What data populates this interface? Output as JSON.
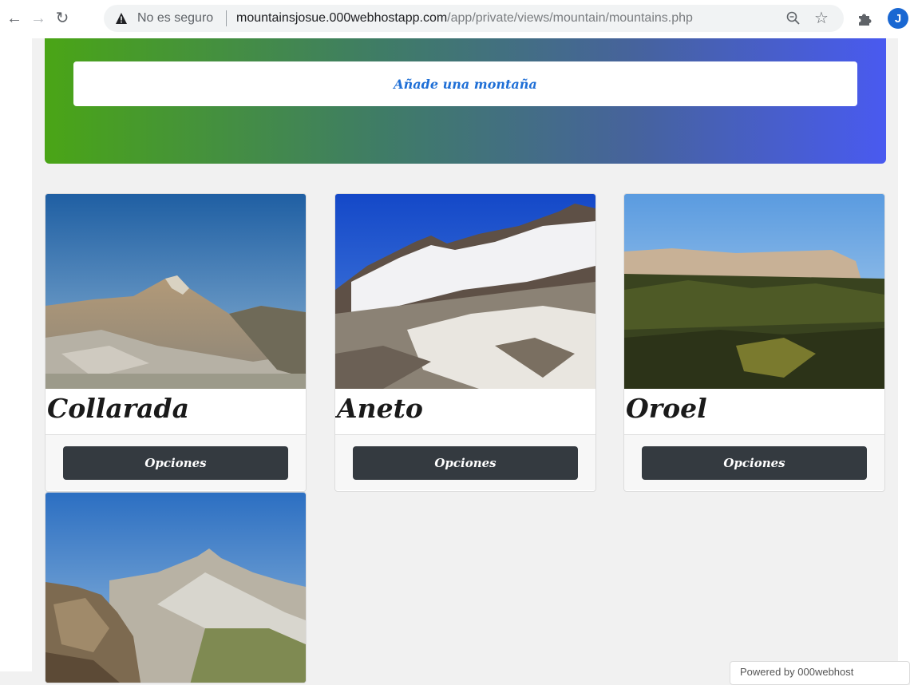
{
  "browser": {
    "security_label": "No es seguro",
    "url_host": "mountainsjosue.000webhostapp.com",
    "url_path": "/app/private/views/mountain/mountains.php",
    "avatar_letter": "J"
  },
  "hero": {
    "add_button_label": "Añade una montaña",
    "gradient_start": "#4aa516",
    "gradient_end": "#495af0"
  },
  "mountains": [
    {
      "name": "Collarada",
      "options_label": "Opciones"
    },
    {
      "name": "Aneto",
      "options_label": "Opciones"
    },
    {
      "name": "Oroel",
      "options_label": "Opciones"
    },
    {
      "name": "",
      "options_label": ""
    }
  ],
  "footer": {
    "watermark_text": "Powered by 000webhost"
  },
  "colors": {
    "button_dark": "#343a40",
    "link_blue": "#1f6fd6"
  }
}
